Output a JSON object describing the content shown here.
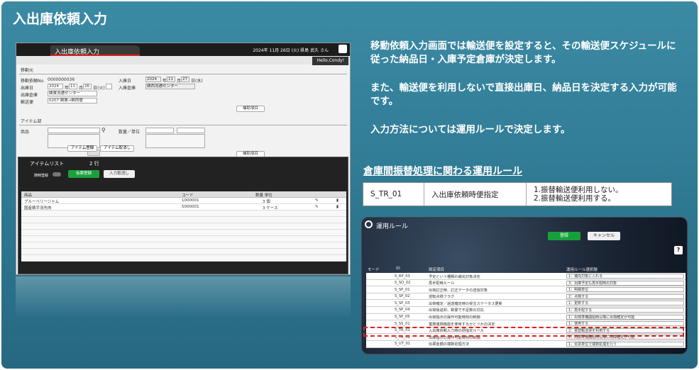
{
  "slide": {
    "title": "入出庫依頼入力",
    "description": [
      "移動依頼入力画面では輸送便を設定すると、その輸送便スケジュールに従った納品日・入庫予定倉庫が決定します。",
      "また、輸送便を利用しないで直接出庫日、納品日を決定する入力が可能です。",
      "入力方法については運用ルールで決定します。"
    ],
    "rule_section_title": "倉庫間振替処理に関わる運用ルール",
    "rule_table": {
      "id": "S_TR_01",
      "name": "入出庫依頼時便指定",
      "options": [
        "1.振替輸送便利用しない。",
        "2.振替輸送便利用する。"
      ]
    }
  },
  "screen1": {
    "tab_title": "入出庫依頼入力",
    "datetime_user": "2024年 11月 26日 (火) 県島 武久 さん",
    "hello": "Hello,Condy!",
    "section_move": "移動元",
    "move_no_label": "移動依頼No.",
    "move_no": "0000000036",
    "ship_date_label": "出庫日",
    "ship_year": "2024",
    "ship_month": "11",
    "ship_day": "26",
    "ship_dow": "(火)",
    "from_wh_label": "出庫倉庫",
    "from_wh": "関東流通センター",
    "transport_label": "輸送便",
    "transport": "0207 関東→関西便",
    "in_date_label": "入庫日",
    "in_year": "2024",
    "in_month": "11",
    "in_day": "27",
    "in_dow": "(水)",
    "to_wh_label": "入庫倉庫",
    "to_wh": "関西流通センター",
    "supp_btn": "補助項目",
    "section_item": "アイテム部",
    "product_label": "商品",
    "qty_label": "数量／単位",
    "supp_btn2": "補助項目",
    "item_register": "アイテム登録",
    "item_cancel": "アイテム取消し",
    "item_list_title": "アイテムリスト",
    "item_count": "2 行",
    "auto_register": "随時登録",
    "temp_register": "仮票登録",
    "input_cancel": "入力取消し",
    "columns": [
      "商品",
      "コード",
      "数量 単位"
    ],
    "items": [
      {
        "name": "ブルーベリージャム",
        "code": "1000001",
        "qty": "3 個"
      },
      {
        "name": "国産鶏手羽先肉",
        "code": "5000001",
        "qty": "3 ケース"
      }
    ]
  },
  "screen2": {
    "title": "運用ルール",
    "register": "登録",
    "cancel": "キャンセル",
    "help": "?",
    "headers": [
      "モード",
      "ID",
      "設定項目",
      "運用ルール選択肢"
    ],
    "rows": [
      {
        "id": "S_RP_03",
        "name": "予定という種類の補充対象決定",
        "value": "1：補充対象に入れる"
      },
      {
        "id": "S_SO_02",
        "name": "再手配時ルール",
        "value": "3：出庫予定も再手配時の対象"
      },
      {
        "id": "S_SP_01",
        "name": "出荷訂正時、訂正データの送信対象",
        "value": "1：明細単位"
      },
      {
        "id": "S_SP_02",
        "name": "逆転点検フラグ",
        "value": "2：点検する"
      },
      {
        "id": "S_SP_03",
        "name": "出荷確定／過送確定時の受注ステータス更新",
        "value": "1：更新する"
      },
      {
        "id": "S_SP_04",
        "name": "出荷後返却、数量で不足数の対応",
        "value": "1：再手配する"
      },
      {
        "id": "S_SP_05",
        "name": "出荷指示の操作可能時刻の制御",
        "value": "1：出荷準備開始時以降に出荷確定が可能"
      },
      {
        "id": "S_SS_01",
        "name": "業務連携機能を使用するかどうかの決定",
        "value": "1：使用する"
      },
      {
        "id": "S_TR_01",
        "name": "入出庫依頼入力時の便指定ルール",
        "value": "2：振替輸送便を利用する"
      },
      {
        "id": "S_TR_02",
        "name": "出庫指示の操作可能時刻の制御",
        "value": "1：出庫準備開始時以降に出庫確定が可能"
      },
      {
        "id": "S_UT_01",
        "name": "伝票金額の端数処理方法",
        "value": "1：伝票単位で端数処理を行う"
      }
    ]
  }
}
